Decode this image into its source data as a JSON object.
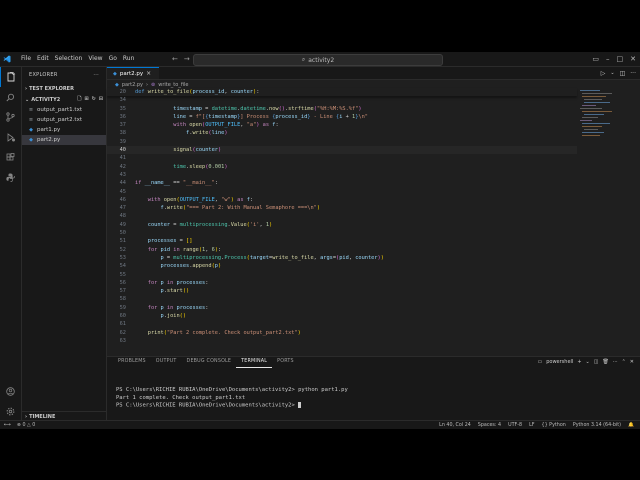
{
  "menu": [
    "File",
    "Edit",
    "Selection",
    "View",
    "Go",
    "Run"
  ],
  "menu_more": "···",
  "search": {
    "text": "activity2"
  },
  "explorer": {
    "title": "EXPLORER",
    "more": "···",
    "test_explorer": "TEST EXPLORER",
    "folder": "ACTIVITY2",
    "files": [
      {
        "name": "output_part1.txt",
        "icon": "≡"
      },
      {
        "name": "output_part2.txt",
        "icon": "≡"
      },
      {
        "name": "part1.py",
        "icon": "◆"
      },
      {
        "name": "part2.py",
        "icon": "◆"
      }
    ],
    "timeline": "TIMELINE"
  },
  "tab": {
    "label": "part2.py",
    "close": "×"
  },
  "breadcrumb": {
    "file": "part2.py",
    "symbol": "write_to_file"
  },
  "code_lines": [
    {
      "n": "20",
      "sticky": true,
      "t": [
        [
          "def ",
          "df"
        ],
        [
          "write_to_file",
          "fn"
        ],
        [
          "(",
          "br1"
        ],
        [
          "process_id",
          "var"
        ],
        [
          ", ",
          "pl"
        ],
        [
          "counter",
          "var"
        ],
        [
          ")",
          "br1"
        ],
        [
          ":",
          "pl"
        ]
      ]
    },
    {
      "n": "34",
      "t": []
    },
    {
      "n": "35",
      "t": [
        [
          "            timestamp ",
          "var"
        ],
        [
          "= ",
          "pl"
        ],
        [
          "datetime",
          "cls"
        ],
        [
          ".",
          "pl"
        ],
        [
          "datetime",
          "cls"
        ],
        [
          ".",
          "pl"
        ],
        [
          "now",
          "fn"
        ],
        [
          "()",
          "br2"
        ],
        [
          ".",
          "pl"
        ],
        [
          "strftime",
          "fn"
        ],
        [
          "(",
          "br2"
        ],
        [
          "\"%H:%M:%S.%f\"",
          "str"
        ],
        [
          ")",
          "br2"
        ]
      ]
    },
    {
      "n": "36",
      "t": [
        [
          "            line ",
          "var"
        ],
        [
          "= ",
          "pl"
        ],
        [
          "f\"[",
          "str"
        ],
        [
          "{",
          "df"
        ],
        [
          "timestamp",
          "var"
        ],
        [
          "}",
          "df"
        ],
        [
          "] Process ",
          "str"
        ],
        [
          "{",
          "df"
        ],
        [
          "process_id",
          "var"
        ],
        [
          "}",
          "df"
        ],
        [
          " - Line ",
          "str"
        ],
        [
          "{",
          "df"
        ],
        [
          "i ",
          "var"
        ],
        [
          "+ ",
          "pl"
        ],
        [
          "1",
          "num"
        ],
        [
          "}",
          "df"
        ],
        [
          "\\n\"",
          "str"
        ]
      ]
    },
    {
      "n": "37",
      "t": [
        [
          "            ",
          "pl"
        ],
        [
          "with ",
          "kw"
        ],
        [
          "open",
          "fn"
        ],
        [
          "(",
          "br2"
        ],
        [
          "OUTPUT_FILE",
          "cst"
        ],
        [
          ", ",
          "pl"
        ],
        [
          "\"a\"",
          "str"
        ],
        [
          ")",
          "br2"
        ],
        [
          " as ",
          "kw"
        ],
        [
          "f",
          "var"
        ],
        [
          ":",
          "pl"
        ]
      ]
    },
    {
      "n": "38",
      "t": [
        [
          "                ",
          "pl"
        ],
        [
          "f",
          "var"
        ],
        [
          ".",
          "pl"
        ],
        [
          "write",
          "fn"
        ],
        [
          "(",
          "br2"
        ],
        [
          "line",
          "var"
        ],
        [
          ")",
          "br2"
        ]
      ]
    },
    {
      "n": "39",
      "t": []
    },
    {
      "n": "40",
      "cur": true,
      "t": [
        [
          "            ",
          "pl"
        ],
        [
          "signal",
          "fn"
        ],
        [
          "(",
          "br2"
        ],
        [
          "counter",
          "var"
        ],
        [
          ")",
          "br2"
        ]
      ]
    },
    {
      "n": "41",
      "t": []
    },
    {
      "n": "42",
      "t": [
        [
          "            ",
          "pl"
        ],
        [
          "time",
          "cls"
        ],
        [
          ".",
          "pl"
        ],
        [
          "sleep",
          "fn"
        ],
        [
          "(",
          "br2"
        ],
        [
          "0.001",
          "num"
        ],
        [
          ")",
          "br2"
        ]
      ]
    },
    {
      "n": "43",
      "t": []
    },
    {
      "n": "44",
      "t": [
        [
          "if ",
          "kw"
        ],
        [
          "__name__ ",
          "var"
        ],
        [
          "== ",
          "pl"
        ],
        [
          "\"__main__\"",
          "str"
        ],
        [
          ":",
          "pl"
        ]
      ]
    },
    {
      "n": "45",
      "t": []
    },
    {
      "n": "46",
      "t": [
        [
          "    ",
          "pl"
        ],
        [
          "with ",
          "kw"
        ],
        [
          "open",
          "fn"
        ],
        [
          "(",
          "br1"
        ],
        [
          "OUTPUT_FILE",
          "cst"
        ],
        [
          ", ",
          "pl"
        ],
        [
          "\"w\"",
          "str"
        ],
        [
          ")",
          "br1"
        ],
        [
          " as ",
          "kw"
        ],
        [
          "f",
          "var"
        ],
        [
          ":",
          "pl"
        ]
      ]
    },
    {
      "n": "47",
      "t": [
        [
          "        ",
          "pl"
        ],
        [
          "f",
          "var"
        ],
        [
          ".",
          "pl"
        ],
        [
          "write",
          "fn"
        ],
        [
          "(",
          "br1"
        ],
        [
          "\"=== Part 2: With Manual Semaphore ===\\n\"",
          "str"
        ],
        [
          ")",
          "br1"
        ]
      ]
    },
    {
      "n": "48",
      "t": []
    },
    {
      "n": "49",
      "t": [
        [
          "    counter ",
          "var"
        ],
        [
          "= ",
          "pl"
        ],
        [
          "multiprocessing",
          "cls"
        ],
        [
          ".",
          "pl"
        ],
        [
          "Value",
          "fn"
        ],
        [
          "(",
          "br1"
        ],
        [
          "'i'",
          "str"
        ],
        [
          ", ",
          "pl"
        ],
        [
          "1",
          "num"
        ],
        [
          ")",
          "br1"
        ]
      ]
    },
    {
      "n": "50",
      "t": []
    },
    {
      "n": "51",
      "t": [
        [
          "    processes ",
          "var"
        ],
        [
          "= ",
          "pl"
        ],
        [
          "[]",
          "br1"
        ]
      ]
    },
    {
      "n": "52",
      "t": [
        [
          "    ",
          "pl"
        ],
        [
          "for ",
          "kw"
        ],
        [
          "pid ",
          "var"
        ],
        [
          "in ",
          "kw"
        ],
        [
          "range",
          "fn"
        ],
        [
          "(",
          "br1"
        ],
        [
          "1",
          "num"
        ],
        [
          ", ",
          "pl"
        ],
        [
          "6",
          "num"
        ],
        [
          ")",
          "br1"
        ],
        [
          ":",
          "pl"
        ]
      ]
    },
    {
      "n": "53",
      "t": [
        [
          "        p ",
          "var"
        ],
        [
          "= ",
          "pl"
        ],
        [
          "multiprocessing",
          "cls"
        ],
        [
          ".",
          "pl"
        ],
        [
          "Process",
          "cls"
        ],
        [
          "(",
          "br1"
        ],
        [
          "target",
          "var"
        ],
        [
          "=",
          "pl"
        ],
        [
          "write_to_file",
          "fn"
        ],
        [
          ", ",
          "pl"
        ],
        [
          "args",
          "var"
        ],
        [
          "=",
          "pl"
        ],
        [
          "(",
          "br2"
        ],
        [
          "pid",
          "var"
        ],
        [
          ", ",
          "pl"
        ],
        [
          "counter",
          "var"
        ],
        [
          ")",
          "br2"
        ],
        [
          ")",
          "br1"
        ]
      ]
    },
    {
      "n": "54",
      "t": [
        [
          "        processes",
          "var"
        ],
        [
          ".",
          "pl"
        ],
        [
          "append",
          "fn"
        ],
        [
          "(",
          "br1"
        ],
        [
          "p",
          "var"
        ],
        [
          ")",
          "br1"
        ]
      ]
    },
    {
      "n": "55",
      "t": []
    },
    {
      "n": "56",
      "t": [
        [
          "    ",
          "pl"
        ],
        [
          "for ",
          "kw"
        ],
        [
          "p ",
          "var"
        ],
        [
          "in ",
          "kw"
        ],
        [
          "processes",
          "var"
        ],
        [
          ":",
          "pl"
        ]
      ]
    },
    {
      "n": "57",
      "t": [
        [
          "        p",
          "var"
        ],
        [
          ".",
          "pl"
        ],
        [
          "start",
          "fn"
        ],
        [
          "()",
          "br1"
        ]
      ]
    },
    {
      "n": "58",
      "t": []
    },
    {
      "n": "59",
      "t": [
        [
          "    ",
          "pl"
        ],
        [
          "for ",
          "kw"
        ],
        [
          "p ",
          "var"
        ],
        [
          "in ",
          "kw"
        ],
        [
          "processes",
          "var"
        ],
        [
          ":",
          "pl"
        ]
      ]
    },
    {
      "n": "60",
      "t": [
        [
          "        p",
          "var"
        ],
        [
          ".",
          "pl"
        ],
        [
          "join",
          "fn"
        ],
        [
          "()",
          "br1"
        ]
      ]
    },
    {
      "n": "61",
      "t": []
    },
    {
      "n": "62",
      "t": [
        [
          "    ",
          "pl"
        ],
        [
          "print",
          "fn"
        ],
        [
          "(",
          "br1"
        ],
        [
          "\"Part 2 complete. Check output_part2.txt\"",
          "str"
        ],
        [
          ")",
          "br1"
        ]
      ]
    },
    {
      "n": "63",
      "t": []
    }
  ],
  "panel": {
    "tabs": [
      "PROBLEMS",
      "OUTPUT",
      "DEBUG CONSOLE",
      "TERMINAL",
      "PORTS"
    ],
    "active_tab": "TERMINAL",
    "shell": "powershell",
    "terminal_lines": [
      "PS C:\\Users\\RICHIE RUBIA\\OneDrive\\Documents\\activity2> python part1.py",
      "Part 1 complete. Check output_part1.txt",
      "PS C:\\Users\\RICHIE RUBIA\\OneDrive\\Documents\\activity2> "
    ]
  },
  "status": {
    "errors": "0",
    "warnings": "0",
    "position": "Ln 40, Col 24",
    "spaces": "Spaces: 4",
    "encoding": "UTF-8",
    "eol": "LF",
    "language": "Python",
    "interpreter": "Python 3.14 (64-bit)"
  },
  "colors": {
    "accent": "#0078d4",
    "editor_bg": "#1f1f1f",
    "sidebar_bg": "#181818"
  }
}
